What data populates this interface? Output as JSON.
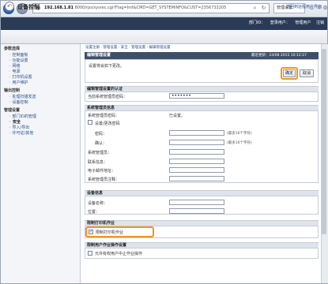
{
  "browser": {
    "back_label": "←",
    "forward_label": "→",
    "url_host": "192.168.1.81",
    "url_rest": " 8000/rps/sysrec.cgi?Flag=Init&CMD=GET_SYSTEMINFO&CUST=2356733205",
    "search_icon": "⌕",
    "refresh_icon": "↻",
    "tab_label": "管理设置",
    "home_icon": "⌂",
    "star_icon": "☆",
    "gear_icon": "⚙"
  },
  "appbar": {
    "links": [
      "部门ID：",
      "登录用户：",
      "管理用户",
      "注销"
    ]
  },
  "titlebar": {
    "title": "设备控制",
    "top_link": "返回到远程用户界面"
  },
  "sidebar": {
    "section1": "参数选择",
    "section1_items": [
      "控制面板",
      "功能设置",
      "网络",
      "电源",
      "打印机设置",
      "用户维护"
    ],
    "section2": "输出控制",
    "section2_items": [
      "处理扫描发送",
      "设备控制"
    ],
    "section3": "管理设置",
    "section3_items": [
      "部门ID的管理",
      "安全",
      "导入/导出",
      "许可证/其他"
    ]
  },
  "main": {
    "breadcrumb": "设置注册 : 管理设置 : 安全 : 管理设置 : 编辑管理设置",
    "panel_title": "编辑管理设置",
    "last_updated": "最近更新：24/08 2015 10:12:27",
    "message": "设置将会如下更改。",
    "ok_label": "确定",
    "cancel_label": "取消",
    "auth_section": "编辑管理设置的认证",
    "current_pw_label": "当前系统管理员密码：",
    "current_pw_value": "•••••••",
    "sysmgr_section": "系统管理员信息",
    "sysmgr_pw_label": "系统管理员密码：",
    "sysmgr_pw_status": "已设置。",
    "change_pw_label": "设置/更改密码",
    "password_label": "密码：",
    "password_hint": "(最多16个字符)",
    "confirm_label": "确认：",
    "confirm_hint": "(最多16个字符)",
    "sysmgr_id_label": "系统管理员：",
    "contact_label": "联系信息：",
    "email_label": "电子邮件地址：",
    "comment_label": "系统管理员注释：",
    "device_section": "设备信息",
    "device_name_label": "设备名称：",
    "location_label": "位置：",
    "restrict_section": "限制打印机作业",
    "restrict_print_label": "限制打印机作业",
    "restrict_print_checked": "✓",
    "ui_section": "限制用户作业操作设置",
    "ui_restrict_label": "允许有权用户中止作业操作"
  }
}
